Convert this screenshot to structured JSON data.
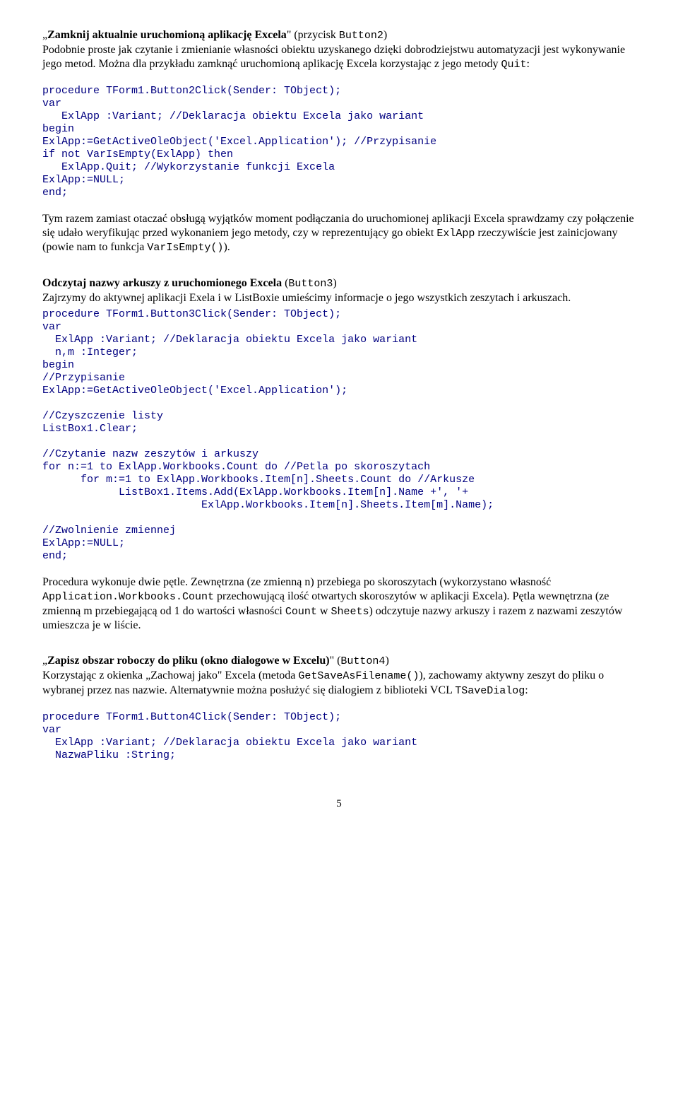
{
  "sec1": {
    "heading_pre": "„",
    "heading_bold": "Zamknij aktualnie uruchomioną aplikację Excela",
    "heading_post": "\" (przycisk ",
    "heading_code": "Button2",
    "heading_end": ")",
    "p1": "Podobnie proste jak czytanie i zmienianie własności obiektu uzyskanego dzięki dobrodziejstwu automatyzacji jest wykonywanie jego metod. Można dla przykładu zamknąć uruchomioną aplikację Excela korzystając z jego metody ",
    "p1_code": "Quit",
    "p1_end": ":",
    "code": "procedure TForm1.Button2Click(Sender: TObject);\nvar\n   ExlApp :Variant; //Deklaracja obiektu Excela jako wariant\nbegin\nExlApp:=GetActiveOleObject('Excel.Application'); //Przypisanie\nif not VarIsEmpty(ExlApp) then\n   ExlApp.Quit; //Wykorzystanie funkcji Excela\nExlApp:=NULL;\nend;",
    "p2a": "Tym razem zamiast otaczać obsługą wyjątków moment podłączania do uruchomionej aplikacji Excela sprawdzamy czy połączenie się udało weryfikując przed wykonaniem jego metody, czy w reprezentujący go obiekt ",
    "p2code1": "ExlApp",
    "p2b": " rzeczywiście jest zainicjowany (powie nam to funkcja ",
    "p2code2": "VarIsEmpty()",
    "p2c": ")."
  },
  "sec2": {
    "heading_bold": "Odczytaj nazwy arkuszy z uruchomionego Excela",
    "heading_post": " (",
    "heading_code": "Button3",
    "heading_end": ")",
    "p1": "Zajrzymy do aktywnej aplikacji Exela i w ListBoxie umieścimy informacje o jego wszystkich zeszytach i arkuszach.",
    "code": "procedure TForm1.Button3Click(Sender: TObject);\nvar\n  ExlApp :Variant; //Deklaracja obiektu Excela jako wariant\n  n,m :Integer;\nbegin\n//Przypisanie\nExlApp:=GetActiveOleObject('Excel.Application');\n\n//Czyszczenie listy\nListBox1.Clear;\n\n//Czytanie nazw zeszytów i arkuszy\nfor n:=1 to ExlApp.Workbooks.Count do //Petla po skoroszytach\n      for m:=1 to ExlApp.Workbooks.Item[n].Sheets.Count do //Arkusze\n            ListBox1.Items.Add(ExlApp.Workbooks.Item[n].Name +', '+\n                         ExlApp.Workbooks.Item[n].Sheets.Item[m].Name);\n\n//Zwolnienie zmiennej\nExlApp:=NULL;\nend;",
    "p2a": "Procedura wykonuje dwie pętle. Zewnętrzna (ze zmienną n) przebiega po skoroszytach (wykorzystano własność ",
    "p2code1": "Application.Workbooks.Count",
    "p2b": " przechowującą ilość otwartych skoroszytów w aplikacji Excela). Pętla wewnętrzna (ze zmienną m przebiegającą od 1 do wartości własności ",
    "p2code2": "Count",
    "p2c": " w ",
    "p2code3": "Sheets",
    "p2d": ") odczytuje nazwy arkuszy i razem z nazwami zeszytów umieszcza je w liście."
  },
  "sec3": {
    "heading_pre": "„",
    "heading_bold": "Zapisz obszar roboczy do pliku (okno dialogowe w Excelu)",
    "heading_post": "\" (",
    "heading_code": "Button4",
    "heading_end": ")",
    "p1a": "Korzystając z okienka „Zachowaj jako\" Excela (metoda ",
    "p1code1": "GetSaveAsFilename()",
    "p1b": "), zachowamy aktywny zeszyt do pliku o wybranej przez nas nazwie. Alternatywnie można posłużyć się dialogiem z biblioteki VCL ",
    "p1code2": "TSaveDialog",
    "p1c": ":",
    "code": "procedure TForm1.Button4Click(Sender: TObject);\nvar\n  ExlApp :Variant; //Deklaracja obiektu Excela jako wariant\n  NazwaPliku :String;"
  },
  "pagenum": "5"
}
